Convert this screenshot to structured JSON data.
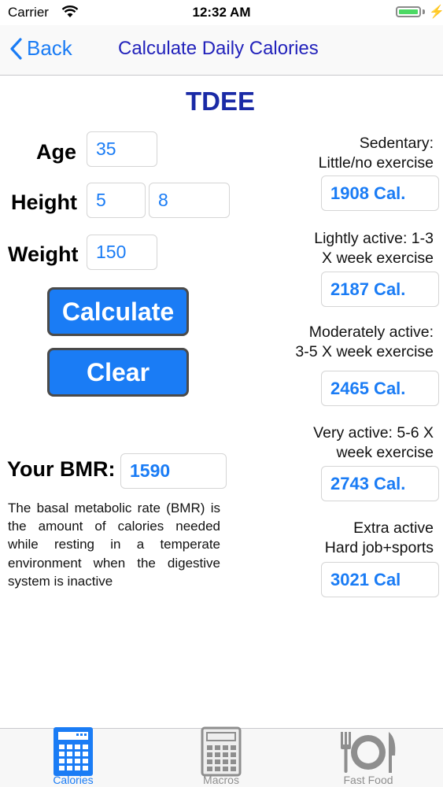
{
  "status": {
    "carrier": "Carrier",
    "time": "12:32 AM"
  },
  "nav": {
    "back": "Back",
    "title": "Calculate Daily Calories"
  },
  "heading": "TDEE",
  "form": {
    "age_label": "Age",
    "age": "35",
    "height_label": "Height",
    "height_ft": "5",
    "height_in": "8",
    "weight_label": "Weight",
    "weight": "150"
  },
  "buttons": {
    "calculate": "Calculate",
    "clear": "Clear"
  },
  "bmr": {
    "label": "Your BMR:",
    "value": "1590",
    "description": "The basal metabolic rate (BMR) is the amount of calories needed while resting in a temperate environment when the digestive system is inactive"
  },
  "activity": [
    {
      "line1": "Sedentary:",
      "line2": "Little/no exercise",
      "cal": "1908 Cal."
    },
    {
      "line1": "Lightly active: 1-3",
      "line2": "X week exercise",
      "cal": "2187 Cal."
    },
    {
      "line1": "Moderately active:",
      "line2": "3-5 X week exercise",
      "cal": "2465 Cal."
    },
    {
      "line1": "Very active: 5-6 X",
      "line2": "week exercise",
      "cal": "2743 Cal."
    },
    {
      "line1": "Extra active",
      "line2": "Hard job+sports",
      "cal": "3021 Cal"
    }
  ],
  "tabs": [
    {
      "label": "Calories",
      "icon": "calculator-icon",
      "active": true
    },
    {
      "label": "Macros",
      "icon": "calculator-icon",
      "active": false
    },
    {
      "label": "Fast Food",
      "icon": "plate-icon",
      "active": false
    }
  ],
  "colors": {
    "accent": "#1a7cf5",
    "title": "#2222bb",
    "heading": "#1a2aa6",
    "battery": "#4cd964"
  }
}
